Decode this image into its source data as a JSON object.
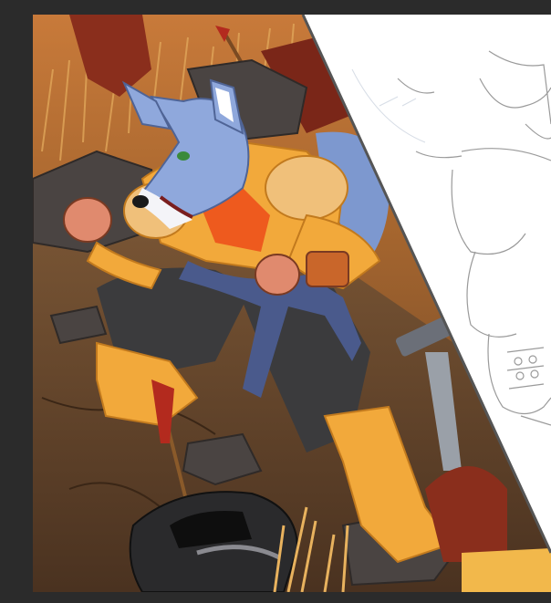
{
  "app": {
    "background_color": "#2b2b2b"
  },
  "artwork": {
    "subject": "wolf-warrior",
    "panels": [
      {
        "name": "colored-illustration"
      },
      {
        "name": "line-sketch"
      }
    ],
    "palette": {
      "fur": "#8fa8dc",
      "armor": "#f2a93b",
      "pants": "#3b3b3d",
      "belt": "#4a5a8c",
      "ground": "#6b4a2e",
      "grass": "#c98a3c",
      "paper": "#ffffff",
      "line": "#9a9a9a"
    }
  }
}
